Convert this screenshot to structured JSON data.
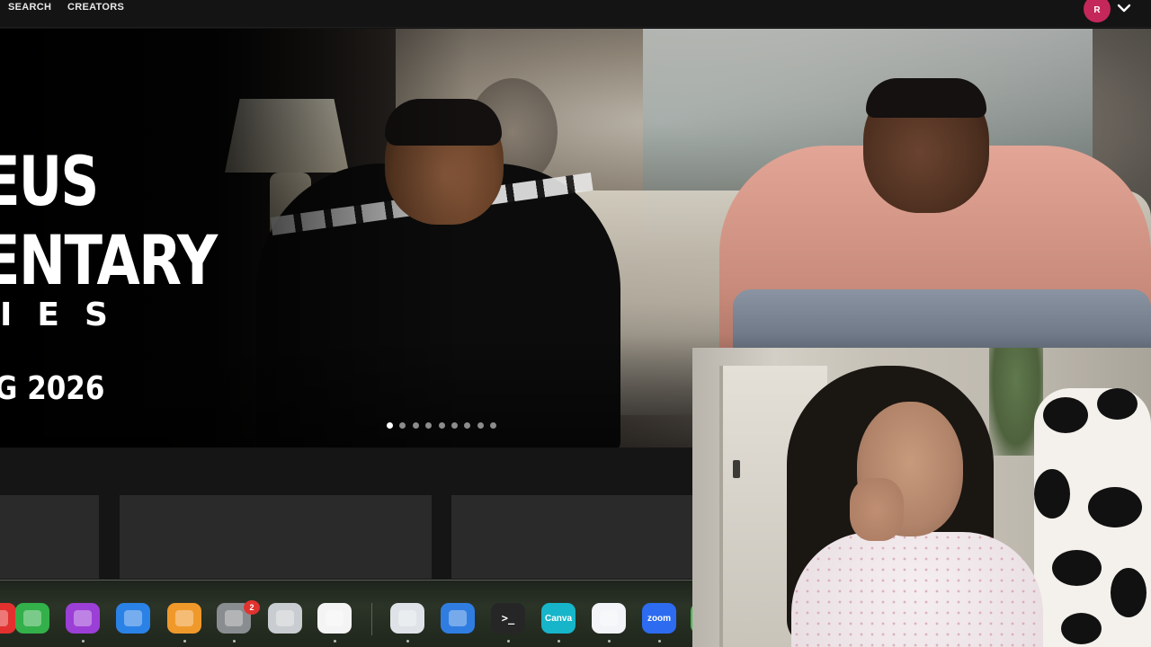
{
  "nav": {
    "links": [
      "SEARCH",
      "CREATORS"
    ],
    "avatar_initial": "R"
  },
  "hero": {
    "line1": "EUS",
    "line2": "ENTARY",
    "line3": "IES",
    "line4": "G 2026",
    "slide_count": 9,
    "active_slide": 1
  },
  "dock": {
    "icons": [
      {
        "name": "app-partial-icon",
        "color": "#e2312f"
      },
      {
        "name": "numbers-icon",
        "color": "#33b04a"
      },
      {
        "name": "podcasts-icon",
        "color": "#9b3fd6"
      },
      {
        "name": "keynote-icon",
        "color": "#2b82e6"
      },
      {
        "name": "pages-icon",
        "color": "#f0992b"
      },
      {
        "name": "system-settings-icon",
        "color": "#8a8d90",
        "badge": "2"
      },
      {
        "name": "iphone-mirroring-icon",
        "color": "#c9ccd0"
      },
      {
        "name": "freeform-icon",
        "color": "#f4f4f4"
      },
      {
        "name": "preview-icon",
        "color": "#dfe3e8"
      },
      {
        "name": "bluetooth-icon",
        "color": "#2f7de1"
      },
      {
        "name": "terminal-icon",
        "color": "#262626",
        "label": ">_"
      },
      {
        "name": "canva-icon",
        "color": "#17b5c9",
        "label": "Canva"
      },
      {
        "name": "vscode-icon",
        "color": "#f2f4f7"
      },
      {
        "name": "zoom-icon",
        "color": "#2d6cf0",
        "label": "zoom"
      },
      {
        "name": "app-partial-right-icon",
        "color": "#3fbf4a"
      }
    ]
  }
}
